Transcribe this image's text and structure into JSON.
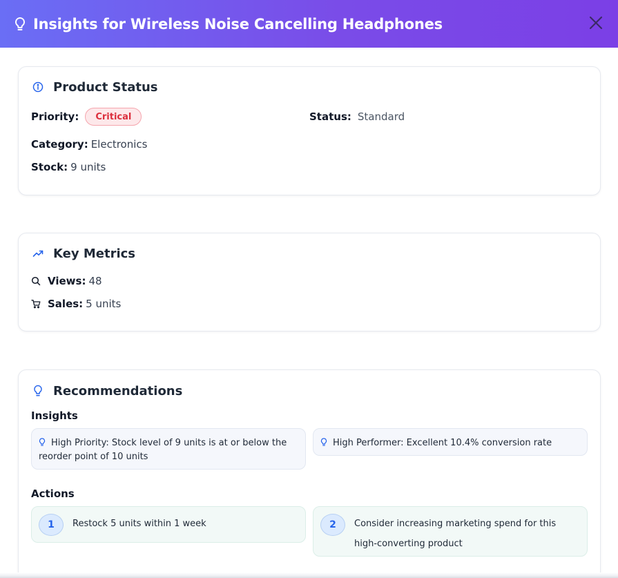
{
  "header": {
    "title": "Insights for Wireless Noise Cancelling Headphones",
    "close_icon": "close-icon",
    "title_icon": "lightbulb-icon"
  },
  "product_status": {
    "title": "Product Status",
    "icon": "info-icon",
    "priority_label": "Priority:",
    "priority_value": "Critical",
    "status_label": "Status:",
    "status_value": "Standard",
    "category_label": "Category:",
    "category_value": "Electronics",
    "stock_label": "Stock:",
    "stock_value": "9 units"
  },
  "key_metrics": {
    "title": "Key Metrics",
    "icon": "trending-up-icon",
    "views_label": "Views:",
    "views_value": "48",
    "sales_label": "Sales:",
    "sales_value": "5 units"
  },
  "recommendations": {
    "title": "Recommendations",
    "icon": "lightbulb-icon",
    "insights_heading": "Insights",
    "insights": [
      "High Priority: Stock level of 9 units is at or below the reorder point of 10 units",
      "High Performer: Excellent 10.4% conversion rate"
    ],
    "actions_heading": "Actions",
    "actions": [
      {
        "number": "1",
        "text": "Restock 5 units within 1 week"
      },
      {
        "number": "2",
        "text": "Consider increasing marketing spend for this high-converting product"
      }
    ]
  },
  "colors": {
    "header_gradient_start": "#6a6ef5",
    "header_gradient_end": "#7b3fe6",
    "accent_blue": "#2563eb",
    "critical_red": "#dc2f3d",
    "critical_bg": "#fde8ea"
  }
}
